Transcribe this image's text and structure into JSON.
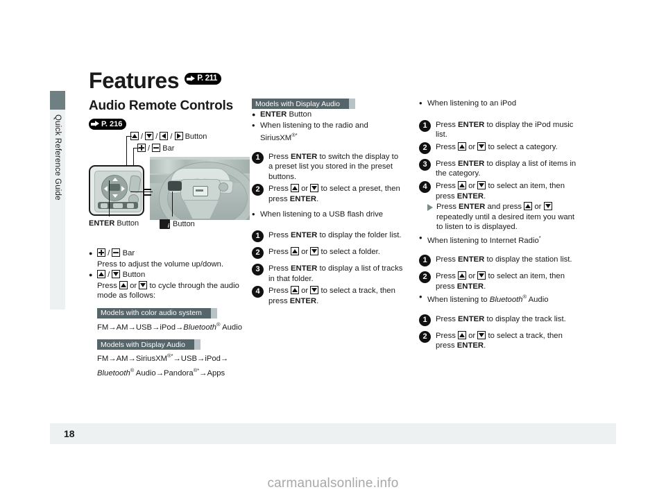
{
  "sidebar": {
    "label": "Quick Reference Guide"
  },
  "header": {
    "title": "Features",
    "title_ref": "P. 211",
    "subtitle": "Audio Remote Controls",
    "subtitle_ref": "P. 216"
  },
  "figure": {
    "callout_buttons": " /  /  /  Button",
    "callout_bar": " /  Bar",
    "caption_enter": "ENTER Button",
    "caption_info": "Button"
  },
  "left_column": {
    "items": [
      {
        "heading_suffix": " Bar",
        "body": "Press to adjust the volume up/down."
      },
      {
        "heading_suffix": " Button",
        "body_a": "Press ",
        "body_b": " or ",
        "body_c": " to cycle through the audio mode as follows:"
      }
    ],
    "band_color": "Models with color audio system",
    "chain_color": "FM→AM→USB→iPod→",
    "chain_color_tail": " Audio",
    "band_display": "Models with Display Audio",
    "chain_display_1": "FM→AM→SiriusXM",
    "chain_display_1b": "→USB→iPod→",
    "chain_display_2a": "Bluetooth",
    "chain_display_2b": " Audio→Pandora",
    "chain_display_2c": "→Apps",
    "bluetooth_word": "Bluetooth"
  },
  "middle_column": {
    "band": "Models with Display Audio",
    "heading": "ENTER Button",
    "section1": "When listening to the radio and SiriusXM",
    "steps1": [
      {
        "n": "1",
        "text_a": "Press ",
        "bold": "ENTER",
        "text_b": " to switch the display to a preset list you stored in the preset buttons."
      },
      {
        "n": "2",
        "text_a": "Press ",
        "text_b": " or ",
        "text_c": " to select a preset, then press ",
        "bold2": "ENTER",
        "text_d": "."
      }
    ],
    "section2": "When listening to a USB flash drive",
    "steps2": [
      {
        "n": "1",
        "text_a": "Press ",
        "bold": "ENTER",
        "text_b": " to display the folder list."
      },
      {
        "n": "2",
        "text_a": "Press ",
        "text_b": " or ",
        "text_c": " to select a folder."
      },
      {
        "n": "3",
        "text_a": "Press ",
        "bold": "ENTER",
        "text_b": " to display a list of tracks in that folder."
      },
      {
        "n": "4",
        "text_a": "Press ",
        "text_b": " or ",
        "text_c": " to select a track, then press ",
        "bold2": "ENTER",
        "text_d": "."
      }
    ]
  },
  "right_column": {
    "section1": "When listening to an iPod",
    "steps1": [
      {
        "n": "1",
        "text_a": "Press ",
        "bold": "ENTER",
        "text_b": " to display the iPod music list."
      },
      {
        "n": "2",
        "text_a": "Press ",
        "text_b": " or ",
        "text_c": " to select a category."
      },
      {
        "n": "3",
        "text_a": "Press ",
        "bold": "ENTER",
        "text_b": " to display a list of items in the category."
      },
      {
        "n": "4",
        "text_a": "Press ",
        "text_b": " or ",
        "text_c": " to select an item, then press ",
        "bold2": "ENTER",
        "text_d": "."
      }
    ],
    "substep": {
      "text_a": "Press ",
      "bold": "ENTER",
      "text_b": " and press ",
      "text_c": " or ",
      "text_d": " repeatedly until a desired item you want to listen to is displayed."
    },
    "section2": "When listening to Internet Radio",
    "steps2": [
      {
        "n": "1",
        "text_a": "Press ",
        "bold": "ENTER",
        "text_b": " to display the station list."
      },
      {
        "n": "2",
        "text_a": "Press ",
        "text_b": " or ",
        "text_c": " to select an item, then press ",
        "bold2": "ENTER",
        "text_d": "."
      }
    ],
    "section3_a": "When listening to ",
    "section3_b": "Bluetooth",
    "section3_c": " Audio",
    "steps3": [
      {
        "n": "1",
        "text_a": "Press ",
        "bold": "ENTER",
        "text_b": " to display the track list."
      },
      {
        "n": "2",
        "text_a": "Press ",
        "text_b": " or ",
        "text_c": " to select a track, then press ",
        "bold2": "ENTER",
        "text_d": "."
      }
    ]
  },
  "footer": {
    "page_number": "18",
    "watermark": "carmanualsonline.info"
  },
  "colors": {
    "band_bg": "#56656a",
    "sidebar_bg": "#eef1f2",
    "sidebar_cap": "#6f8082",
    "footer_bg": "#eef1f2",
    "pill_bg": "#000000"
  }
}
